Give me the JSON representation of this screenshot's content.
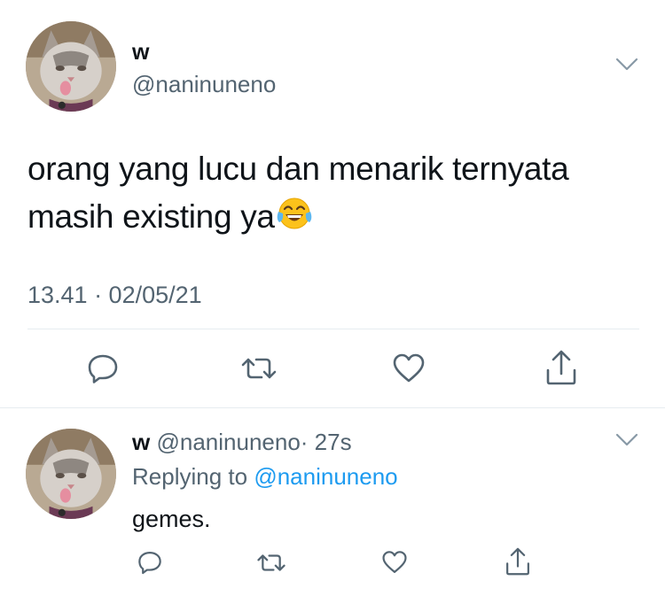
{
  "tweet": {
    "display_name": "w",
    "handle": "@naninuneno",
    "text_line1": "orang yang lucu dan menarik ternyata",
    "text_line2": "masih existing ya",
    "emoji": "face-with-tears-of-joy",
    "timestamp": "13.41 · 02/05/21",
    "actions": [
      "reply-icon",
      "retweet-icon",
      "like-icon",
      "share-icon"
    ]
  },
  "reply": {
    "display_name": "w",
    "handle": "@naninuneno",
    "age": "· 27s",
    "replying_prefix": "Replying to",
    "replying_handle": "@naninuneno",
    "text": "gemes.",
    "actions": [
      "reply-icon",
      "retweet-icon",
      "like-icon",
      "share-icon"
    ]
  },
  "colors": {
    "text": "#0f1419",
    "muted": "#536471",
    "link": "#1d9bf0",
    "divider": "#e6ecf0"
  }
}
